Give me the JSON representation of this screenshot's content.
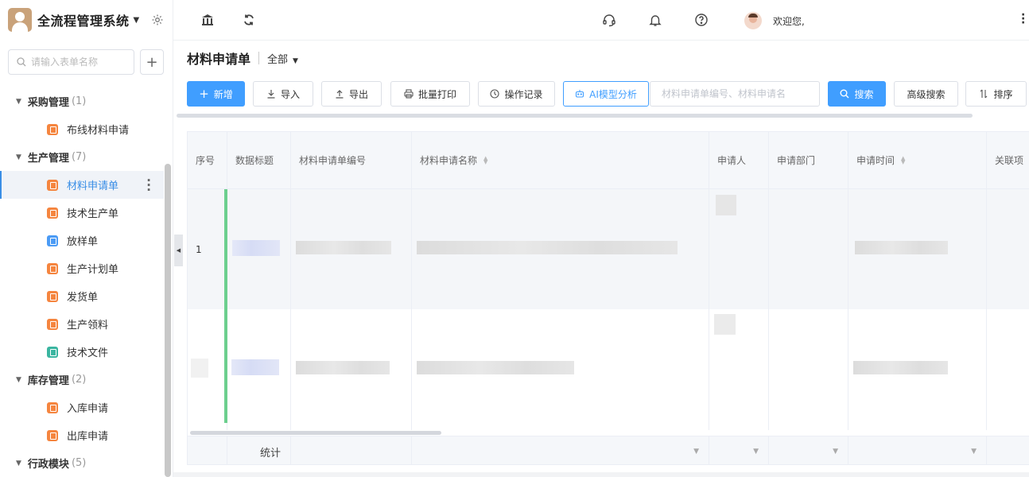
{
  "app": {
    "title": "全流程管理系统"
  },
  "sidebar": {
    "search_placeholder": "请输入表单名称",
    "groups": [
      {
        "label": "采购管理",
        "count": "(1)",
        "items": [
          {
            "label": "布线材料申请",
            "color": "#f5853f"
          }
        ]
      },
      {
        "label": "生产管理",
        "count": "(7)",
        "items": [
          {
            "label": "材料申请单",
            "color": "#f5853f",
            "active": true
          },
          {
            "label": "技术生产单",
            "color": "#f5853f"
          },
          {
            "label": "放样单",
            "color": "#4b9bf5"
          },
          {
            "label": "生产计划单",
            "color": "#f5853f"
          },
          {
            "label": "发货单",
            "color": "#f5853f"
          },
          {
            "label": "生产领料",
            "color": "#f5853f"
          },
          {
            "label": "技术文件",
            "color": "#3ab5a0"
          }
        ]
      },
      {
        "label": "库存管理",
        "count": "(2)",
        "items": [
          {
            "label": "入库申请",
            "color": "#f5853f"
          },
          {
            "label": "出库申请",
            "color": "#f5853f"
          }
        ]
      },
      {
        "label": "行政模块",
        "count": "(5)",
        "items": []
      }
    ]
  },
  "topbar": {
    "icons": [
      "bank-icon",
      "refresh-icon",
      "headset-icon",
      "bell-icon",
      "help-icon"
    ],
    "greeting": "欢迎您,"
  },
  "page": {
    "title": "材料申请单",
    "filter": "全部"
  },
  "toolbar": {
    "add": "新增",
    "import": "导入",
    "export": "导出",
    "batch_print": "批量打印",
    "op_log": "操作记录",
    "ai": "AI模型分析",
    "search_placeholder": "材料申请单编号、材料申请名",
    "search": "搜索",
    "advanced": "高级搜索",
    "sort": "排序"
  },
  "table": {
    "columns": [
      "序号",
      "数据标题",
      "材料申请单编号",
      "材料申请名称",
      "申请人",
      "申请部门",
      "申请时间",
      "关联项"
    ],
    "rows": [
      {
        "index": "1"
      },
      {
        "index": ""
      }
    ],
    "summary_label": "统计"
  },
  "colors": {
    "accent": "#409eff",
    "row_marker": "#6ccf8e"
  }
}
